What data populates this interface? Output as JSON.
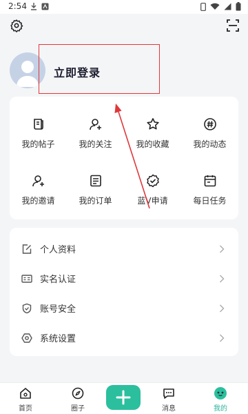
{
  "status_bar": {
    "time": "2:54"
  },
  "header": {
    "login_label": "立即登录"
  },
  "grid_items": [
    {
      "label": "我的帖子",
      "icon": "posts-icon"
    },
    {
      "label": "我的关注",
      "icon": "follow-user-icon"
    },
    {
      "label": "我的收藏",
      "icon": "star-icon"
    },
    {
      "label": "我的动态",
      "icon": "hashtag-icon"
    },
    {
      "label": "我的邀请",
      "icon": "invite-user-icon"
    },
    {
      "label": "我的订单",
      "icon": "order-icon"
    },
    {
      "label": "蓝V申请",
      "icon": "verified-badge-icon"
    },
    {
      "label": "每日任务",
      "icon": "calendar-task-icon"
    }
  ],
  "list_items": [
    {
      "label": "个人资料",
      "icon": "edit-profile-icon"
    },
    {
      "label": "实名认证",
      "icon": "id-card-icon"
    },
    {
      "label": "账号安全",
      "icon": "shield-icon"
    },
    {
      "label": "系统设置",
      "icon": "settings-icon"
    }
  ],
  "tabbar": {
    "items": [
      {
        "label": "首页",
        "icon": "home-icon"
      },
      {
        "label": "圈子",
        "icon": "compass-icon"
      },
      {
        "label": "消息",
        "icon": "message-icon"
      },
      {
        "label": "我的",
        "icon": "profile-face-icon",
        "active": true
      }
    ],
    "plus_icon": "plus-icon"
  },
  "colors": {
    "accent": "#2bbf9e",
    "background": "#f4f5f7",
    "annotation": "#e0373a"
  }
}
